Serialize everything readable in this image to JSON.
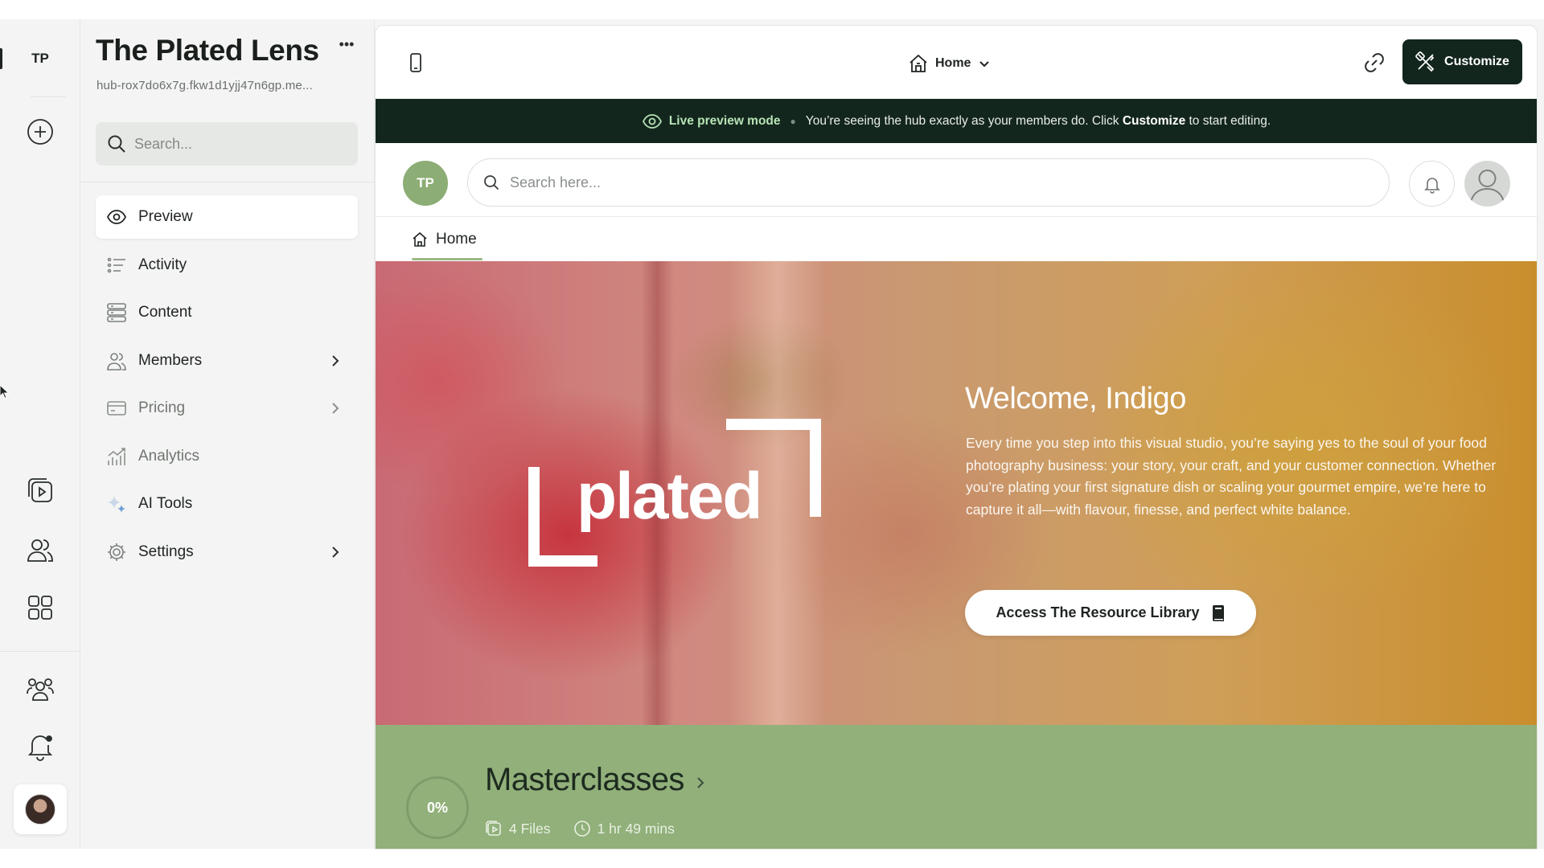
{
  "rail": {
    "workspace_initials": "TP",
    "icons": [
      "add-circle-icon",
      "video-library-icon",
      "people-icon",
      "apps-grid-icon",
      "community-icon",
      "notification-bell-icon"
    ]
  },
  "sidebar": {
    "hub_title": "The Plated Lens",
    "hub_url": "hub-rox7do6x7g.fkw1d1yjj47n6gp.me...",
    "search_placeholder": "Search...",
    "items": [
      {
        "label": "Preview",
        "icon": "eye-icon",
        "active": true
      },
      {
        "label": "Activity",
        "icon": "activity-list-icon"
      },
      {
        "label": "Content",
        "icon": "content-stack-icon"
      },
      {
        "label": "Members",
        "icon": "members-icon",
        "chevron": true
      },
      {
        "label": "Pricing",
        "icon": "credit-card-icon",
        "chevron": true,
        "muted": true
      },
      {
        "label": "Analytics",
        "icon": "analytics-chart-icon",
        "muted": true
      },
      {
        "label": "AI Tools",
        "icon": "sparkle-icon"
      },
      {
        "label": "Settings",
        "icon": "gear-icon",
        "chevron": true
      }
    ]
  },
  "topbar": {
    "page_label": "Home",
    "customize_label": "Customize"
  },
  "banner": {
    "mode_label": "Live preview mode",
    "message_prefix": "You’re seeing the hub exactly as your members do. Click ",
    "message_bold": "Customize",
    "message_suffix": " to start editing."
  },
  "hub": {
    "avatar_initials": "TP",
    "search_placeholder": "Search here...",
    "tab_label": "Home"
  },
  "hero": {
    "logo_word": "plated",
    "welcome": "Welcome, Indigo",
    "body": "Every time you step into this visual studio, you’re saying yes to the soul of your food photography business: your story, your craft, and your customer connection. Whether you’re plating your first signature dish or scaling your gourmet empire, we’re here to capture it all—with flavour, finesse, and perfect white balance.",
    "cta_label": "Access The Resource Library"
  },
  "course": {
    "progress": "0%",
    "title": "Masterclasses",
    "files": "4 Files",
    "duration": "1 hr 49 mins"
  },
  "colors": {
    "dark_green": "#13261e",
    "sage": "#91b07a",
    "avatar_green": "#8cad75"
  }
}
